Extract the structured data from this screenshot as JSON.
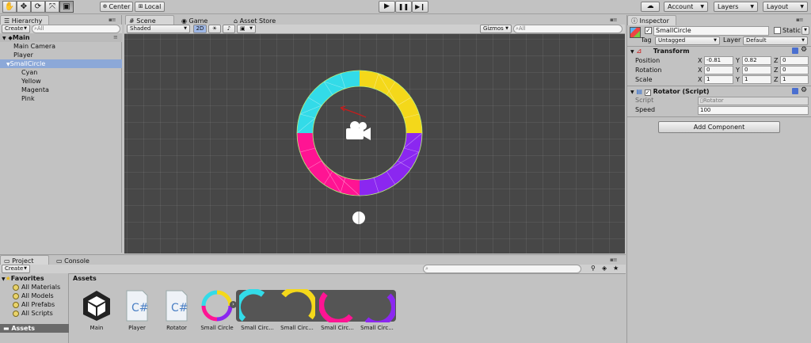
{
  "toolbar": {
    "pivot": "Center",
    "space": "Local",
    "account": "Account",
    "layers": "Layers",
    "layout": "Layout"
  },
  "hierarchy": {
    "tab": "Hierarchy",
    "create": "Create",
    "search_placeholder": "All",
    "scene": "Main",
    "items": [
      "Main Camera",
      "Player",
      "SmallCircle",
      "Cyan",
      "Yellow",
      "Magenta",
      "Pink"
    ]
  },
  "scene": {
    "tabs": [
      "Scene",
      "Game",
      "Asset Store"
    ],
    "shading": "Shaded",
    "mode2d": "2D",
    "gizmos": "Gizmos",
    "search_placeholder": "All"
  },
  "inspector": {
    "tab": "Inspector",
    "object_name": "SmallCircle",
    "static_label": "Static",
    "tag_label": "Tag",
    "tag_value": "Untagged",
    "layer_label": "Layer",
    "layer_value": "Default",
    "transform": {
      "title": "Transform",
      "position_label": "Position",
      "rotation_label": "Rotation",
      "scale_label": "Scale",
      "position": {
        "x": "-0.81",
        "y": "0.82",
        "z": "0"
      },
      "rotation": {
        "x": "0",
        "y": "0",
        "z": "0"
      },
      "scale": {
        "x": "1",
        "y": "1",
        "z": "1"
      }
    },
    "rotator": {
      "title": "Rotator (Script)",
      "script_label": "Script",
      "script_value": "Rotator",
      "speed_label": "Speed",
      "speed_value": "100"
    },
    "add_component": "Add Component"
  },
  "project": {
    "tabs": [
      "Project",
      "Console"
    ],
    "create": "Create",
    "favorites_label": "Favorites",
    "favorites": [
      "All Materials",
      "All Models",
      "All Prefabs",
      "All Scripts"
    ],
    "assets_folder": "Assets",
    "breadcrumb": "Assets",
    "assets": [
      "Main",
      "Player",
      "Rotator",
      "Small Circle",
      "Small Circ...",
      "Small Circ...",
      "Small Circ...",
      "Small Circ..."
    ]
  },
  "colors": {
    "cyan": "#33dbe8",
    "yellow": "#f4d81a",
    "magenta": "#ff1493",
    "purple": "#8b27f0",
    "scene_bg": "#474747",
    "selection": "#3e7de7"
  }
}
